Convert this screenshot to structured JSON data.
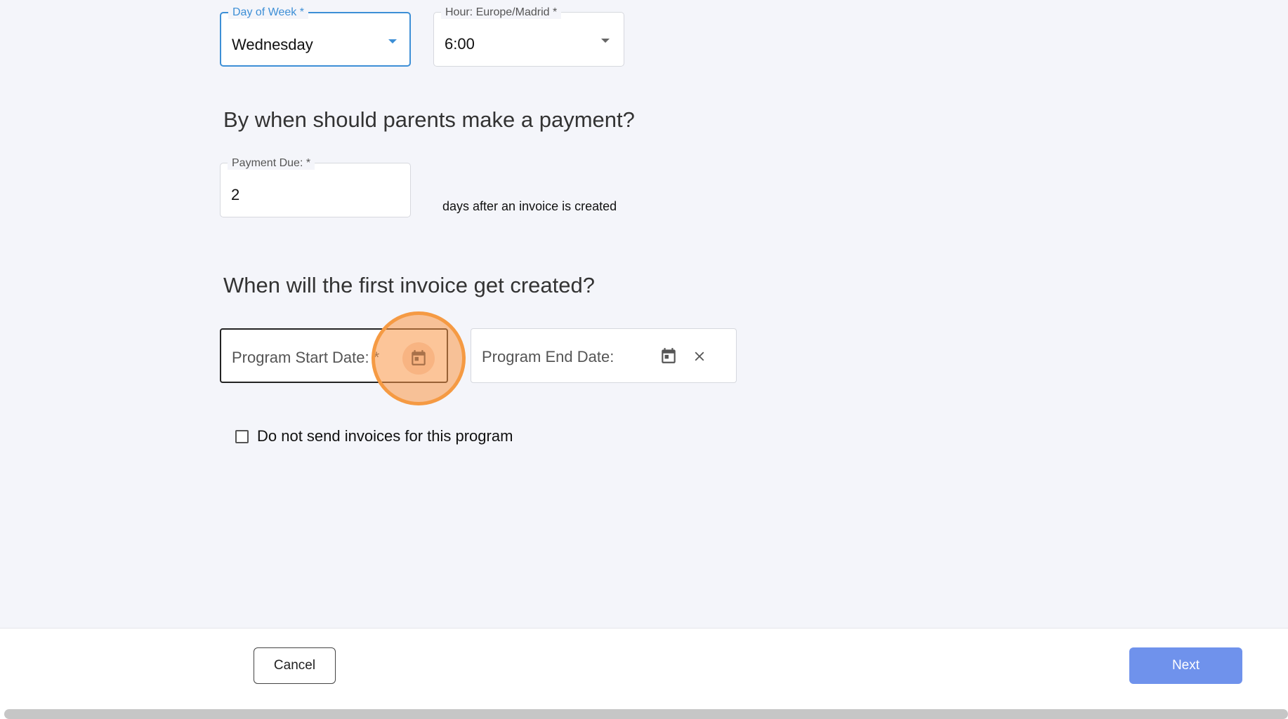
{
  "schedule": {
    "day_of_week": {
      "label": "Day of Week *",
      "value": "Wednesday"
    },
    "hour": {
      "label": "Hour: Europe/Madrid *",
      "value": "6:00"
    }
  },
  "payment": {
    "heading": "By when should parents make a payment?",
    "due_label": "Payment Due: *",
    "due_value": "2",
    "days_text": "days after an invoice is created"
  },
  "invoice": {
    "heading": "When will the first invoice get created?",
    "start_date_placeholder": "Program Start Date: *",
    "end_date_placeholder": "Program End Date:"
  },
  "no_invoices_checkbox": {
    "label": "Do not send invoices for this program",
    "checked": false
  },
  "footer": {
    "cancel_label": "Cancel",
    "next_label": "Next"
  },
  "colors": {
    "accent": "#3d8fd6",
    "next_button": "#6f92ec",
    "highlight": "#f59a43"
  },
  "icons": [
    "chevron-down-icon",
    "calendar-icon",
    "close-icon"
  ]
}
